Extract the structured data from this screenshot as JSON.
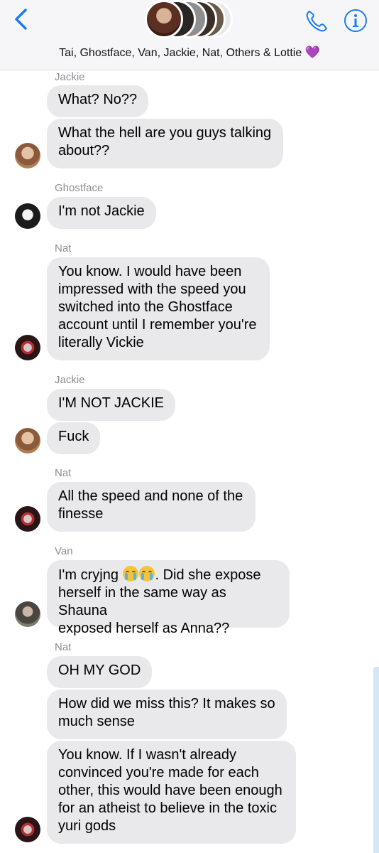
{
  "header": {
    "title": "Tai, Ghostface, Van, Jackie, Nat, Others & Lottie",
    "title_emoji": "💜",
    "back_icon": "chevron-left-icon",
    "phone_icon": "phone-icon",
    "info_icon": "info-icon",
    "accent_color": "#1a7cf3"
  },
  "messages": [
    {
      "sender": "Jackie",
      "text": "What? No??"
    },
    {
      "text_line1": "What the hell are you guys talking",
      "text_line2": "about??"
    },
    {
      "sender": "Ghostface",
      "text": "I'm not Jackie"
    },
    {
      "sender": "Nat",
      "lines": [
        "You know. I would have been",
        "impressed with the speed you",
        "switched into the Ghostface",
        "account until I remember you're",
        "literally Vickie"
      ]
    },
    {
      "sender": "Jackie",
      "text": "I'M NOT JACKIE"
    },
    {
      "text": "Fuck"
    },
    {
      "sender": "Nat",
      "lines": [
        "All the speed and none of the",
        "finesse"
      ]
    },
    {
      "sender": "Van",
      "line1_before": "I'm cryjng ",
      "line1_after": ". Did she expose",
      "lines": [
        "herself in the same way as Shauna",
        "exposed herself as Anna??"
      ],
      "emoji": "loudly-crying-face"
    },
    {
      "sender": "Nat",
      "text": "OH MY GOD"
    },
    {
      "lines": [
        "How did we miss this? It makes so",
        "much sense"
      ]
    },
    {
      "lines": [
        "You know. If I wasn't already",
        "convinced you're made for each",
        "other, this would have been enough",
        "for an atheist to believe in the toxic",
        "yuri gods"
      ]
    }
  ]
}
